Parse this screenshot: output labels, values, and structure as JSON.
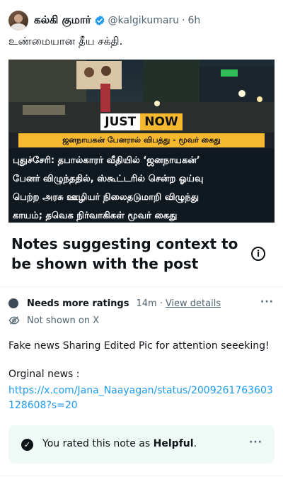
{
  "tweet": {
    "author_name": "கல்கி குமார்",
    "handle": "@kalgikumaru",
    "dot": "·",
    "time": "6h",
    "text": "உண்மையான தீய சக்தி."
  },
  "media": {
    "badge_left": "JUST",
    "badge_right": "NOW",
    "subheadline": "ஜனநாயகன் பேனரால் விபத்து - மூவர் கைது",
    "body_lines": [
      "புதுச்சேரி: தபால்காரர் வீதியில் ‘ஜனநாயகன்’",
      "பேனர் விழுந்ததில், ஸ்கூட்டரில் சென்ற ஓய்வு",
      "பெற்ற அரசு ஊழியர் நிலைதடுமாறி விழுந்து",
      "காயம்; தவெக நிர்வாகிகள் மூவர் கைது"
    ]
  },
  "notes": {
    "title": "Notes suggesting context to be shown with the post",
    "info_icon": "i",
    "status_label": "Needs more ratings",
    "time": "14m",
    "separator": "·",
    "details_link": "View details",
    "more": "···",
    "not_shown": "Not shown on X",
    "note_text": "Fake news Sharing Edited Pic for attention seeeking!",
    "note_subtitle": "Orginal news :",
    "note_link": "https://x.com/Jana_Naayagan/status/2009261763603128608?s=20",
    "rated_prefix": "You rated this note as ",
    "rated_value": "Helpful",
    "rated_suffix": ".",
    "check": "✓"
  },
  "colors": {
    "accent_link": "#1d9bf0",
    "verified_blue": "#1d9bf0",
    "rated_bg": "#effaf6",
    "badge_yellow": "#f5b82e"
  },
  "icons": [
    "verified-badge-icon",
    "info-icon",
    "status-dot-icon",
    "eye-off-icon",
    "more-icon",
    "check-circle-icon"
  ]
}
